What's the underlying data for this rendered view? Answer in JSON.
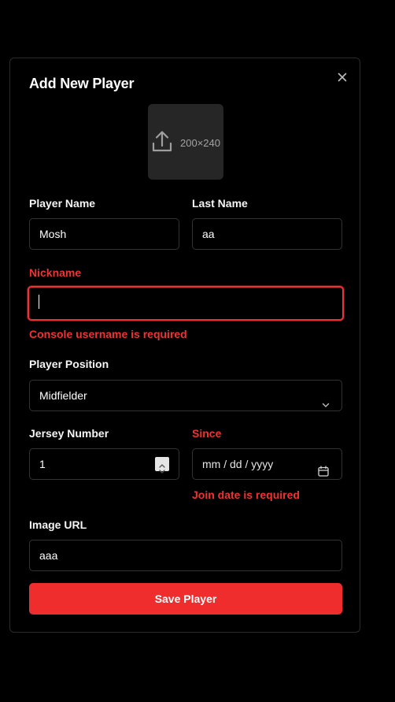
{
  "modal": {
    "title": "Add New Player",
    "close_icon": "close-icon"
  },
  "upload": {
    "icon": "upload-icon",
    "size_text": "200×240"
  },
  "fields": {
    "player_name": {
      "label": "Player Name",
      "value": "Mosh"
    },
    "last_name": {
      "label": "Last Name",
      "value": "aa"
    },
    "nickname": {
      "label": "Nickname",
      "value": "",
      "error": "Console username is required"
    },
    "position": {
      "label": "Player Position",
      "value": "Midfielder"
    },
    "jersey_number": {
      "label": "Jersey Number",
      "value": "1"
    },
    "since": {
      "label": "Since",
      "placeholder": "mm / dd / yyyy",
      "error": "Join date is required"
    },
    "image_url": {
      "label": "Image URL",
      "value": "aaa"
    }
  },
  "save_button": {
    "label": "Save Player"
  },
  "colors": {
    "background": "#000000",
    "error": "#ef3333",
    "primary_button": "#ef2d2d",
    "border": "#333333"
  }
}
